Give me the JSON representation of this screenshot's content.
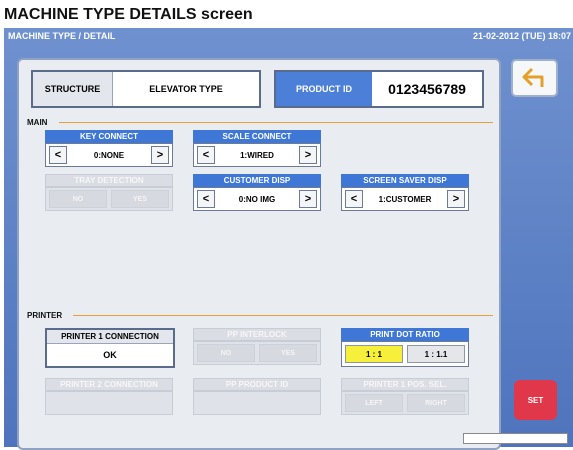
{
  "caption": "MACHINE TYPE DETAILS screen",
  "titlebar": {
    "title": "MACHINE TYPE / DETAIL",
    "datetime": "21-02-2012 (TUE) 18:07"
  },
  "structure": {
    "label": "STRUCTURE",
    "value": "ELEVATOR TYPE"
  },
  "product_id": {
    "label": "PRODUCT ID",
    "value": "0123456789"
  },
  "main": {
    "title": "MAIN",
    "key_connect": {
      "label": "KEY CONNECT",
      "value": "0:NONE"
    },
    "scale_connect": {
      "label": "SCALE CONNECT",
      "value": "1:WIRED"
    },
    "tray_detection": {
      "label": "TRAY DETECTION",
      "no": "NO",
      "yes": "YES"
    },
    "customer_disp": {
      "label": "CUSTOMER DISP",
      "value": "0:NO IMG"
    },
    "screen_saver_disp": {
      "label": "SCREEN SAVER DISP",
      "value": "1:CUSTOMER"
    }
  },
  "printer": {
    "title": "PRINTER",
    "p1_connection": {
      "label": "PRINTER 1 CONNECTION",
      "value": "OK"
    },
    "pp_interlock": {
      "label": "PP INTERLOCK",
      "no": "NO",
      "yes": "YES"
    },
    "print_dot_ratio": {
      "label": "PRINT DOT RATIO",
      "opt1": "1 : 1",
      "opt2": "1 : 1.1",
      "selected": "1 : 1"
    },
    "p2_connection": {
      "label": "PRINTER 2 CONNECTION"
    },
    "pp_product_id": {
      "label": "PP PRODUCT ID"
    },
    "p1_pos_sel": {
      "label": "PRINTER 1 POS. SEL.",
      "left": "LEFT",
      "right": "RIGHT"
    }
  },
  "buttons": {
    "set": "SET"
  },
  "arrows": {
    "left": "<",
    "right": ">"
  },
  "colors": {
    "accent_blue": "#3e77d6",
    "set_red": "#e0374a",
    "selected_yellow": "#f7f03a",
    "section_line": "#e8a03a"
  }
}
